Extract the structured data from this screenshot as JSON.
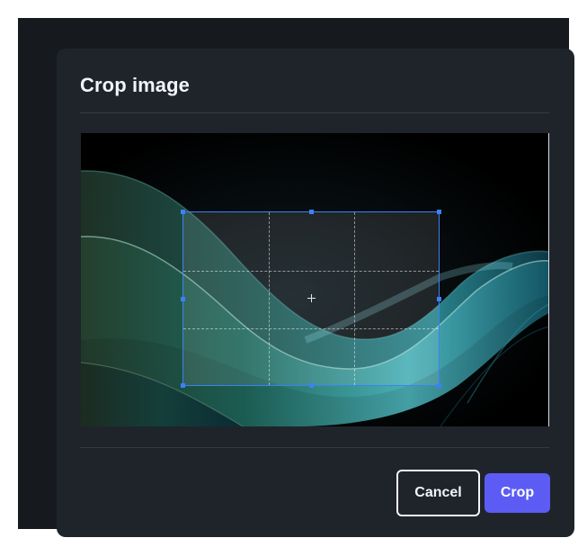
{
  "dialog": {
    "title": "Crop image"
  },
  "buttons": {
    "cancel_label": "Cancel",
    "crop_label": "Crop"
  },
  "colors": {
    "dialog_background": "#1f242b",
    "primary_button": "#5c5cf5",
    "crop_selection_border": "#3b82f6"
  }
}
